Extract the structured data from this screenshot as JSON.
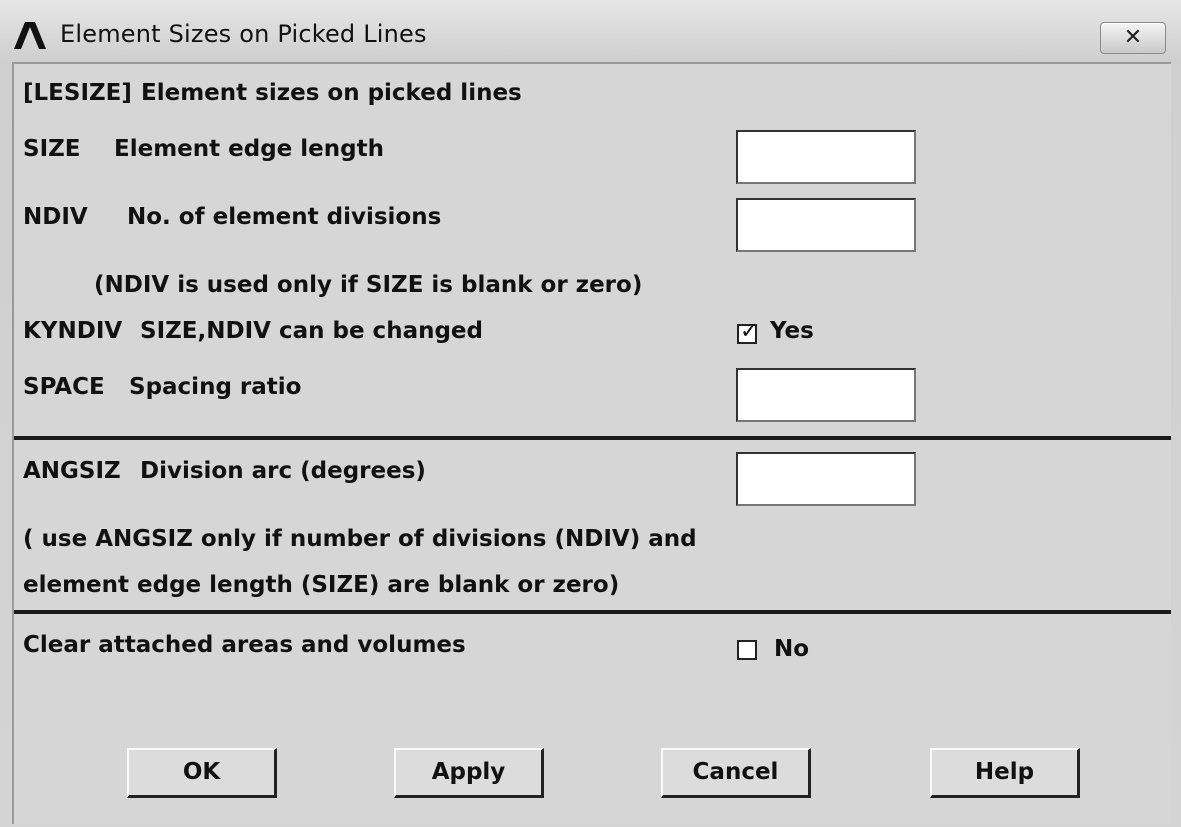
{
  "window": {
    "title": "Element Sizes on Picked Lines",
    "close_glyph": "✕"
  },
  "header": {
    "command": "[LESIZE]",
    "description": "Element sizes on picked lines"
  },
  "size": {
    "key": "SIZE",
    "label": "Element edge length",
    "value": ""
  },
  "ndiv": {
    "key": "NDIV",
    "label": "No. of element divisions",
    "value": "",
    "note": "(NDIV is used only if SIZE is blank or zero)"
  },
  "kyndiv": {
    "key": "KYNDIV",
    "label": "SIZE,NDIV can be changed",
    "checked": true,
    "check_label": "Yes"
  },
  "space": {
    "key": "SPACE",
    "label": "Spacing ratio",
    "value": ""
  },
  "angsiz": {
    "key": "ANGSIZ",
    "label": "Division arc (degrees)",
    "value": "",
    "note_line1": "( use ANGSIZ only if number of divisions (NDIV) and",
    "note_line2": "element edge length (SIZE) are blank or zero)"
  },
  "clear": {
    "label": "Clear attached areas and volumes",
    "checked": false,
    "check_label": "No"
  },
  "buttons": {
    "ok": "OK",
    "apply": "Apply",
    "cancel": "Cancel",
    "help": "Help"
  },
  "icons": {
    "app": "ansys-logo-icon",
    "close": "close-icon",
    "check": "checkmark-icon"
  }
}
